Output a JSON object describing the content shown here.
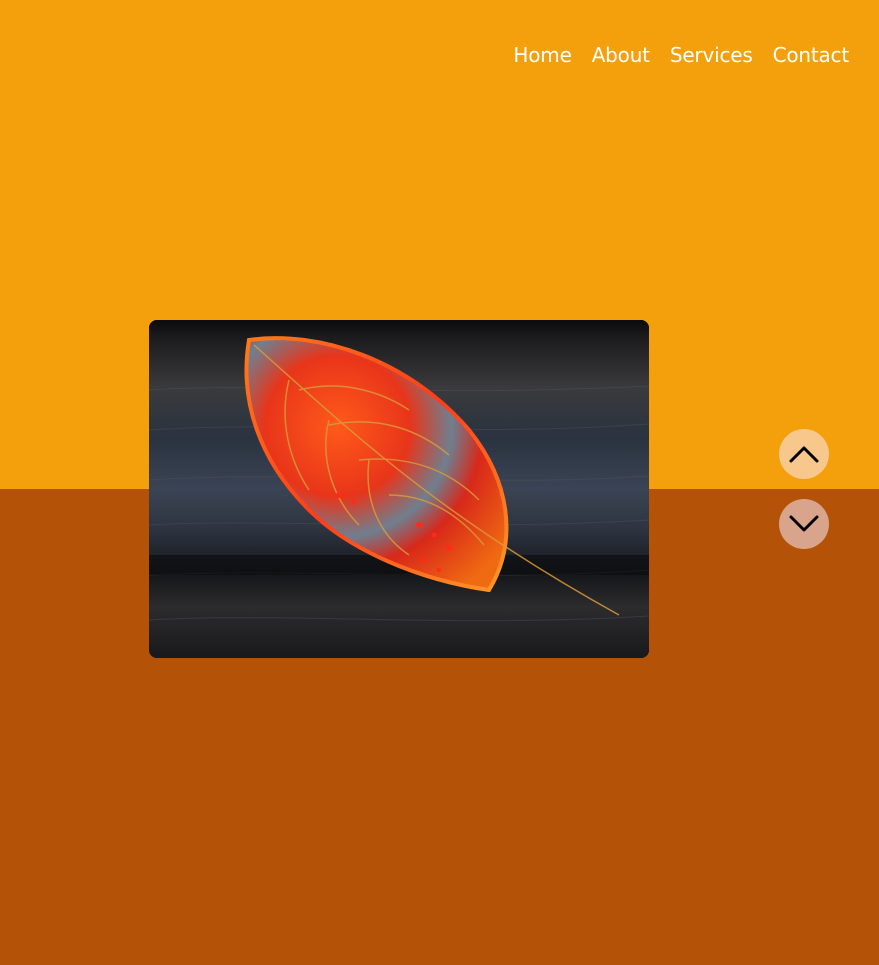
{
  "nav": {
    "items": [
      {
        "label": "Home"
      },
      {
        "label": "About"
      },
      {
        "label": "Services"
      },
      {
        "label": "Contact"
      }
    ]
  },
  "colors": {
    "top_background": "#f3a00c",
    "bottom_background": "#b45208",
    "nav_text": "#ffffff",
    "up_button": "#f8c78c",
    "down_button": "#d8a48b"
  },
  "controls": {
    "up_icon": "chevron-up-icon",
    "down_icon": "chevron-down-icon"
  },
  "image": {
    "subject": "red-orange leaf on dark wood"
  }
}
